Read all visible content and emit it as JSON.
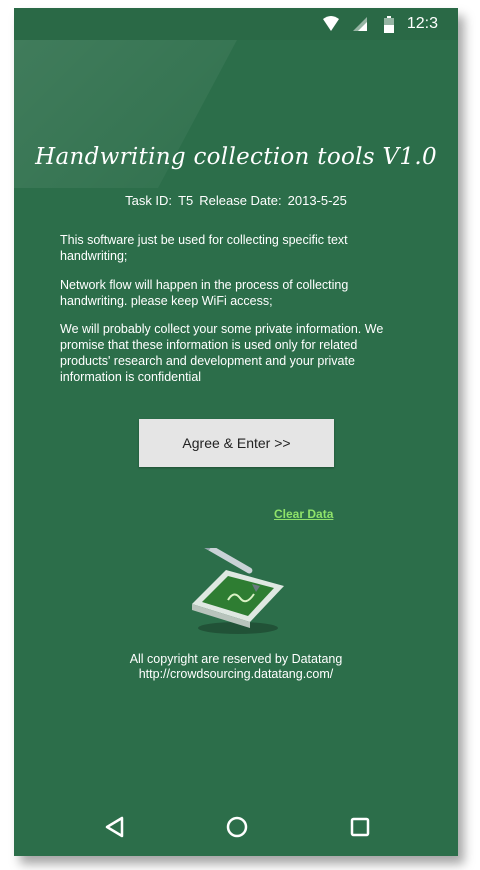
{
  "status_bar": {
    "time": "12:3",
    "icons": [
      "wifi-icon",
      "signal-icon",
      "battery-icon"
    ]
  },
  "title": "Handwriting collection tools V1.0",
  "task": {
    "id_label": "Task ID:",
    "id_value": "T5",
    "date_label": "Release Date:",
    "date_value": "2013-5-25"
  },
  "paragraphs": [
    "This software just be used for collecting specific text handwriting;",
    "Network flow will happen in the process of collecting handwriting. please keep WiFi access;",
    "We will probably collect your some private information. We promise that these information is used only for related products' research and development and your private information is confidential"
  ],
  "agree_button": "Agree & Enter >>",
  "clear_link": "Clear Data",
  "copyright": {
    "line1": "All copyright are reserved by Datatang",
    "line2": "http://crowdsourcing.datatang.com/"
  },
  "nav": [
    "back-icon",
    "home-icon",
    "recents-icon"
  ],
  "colors": {
    "background": "#2c6e4a",
    "link": "#8fe36a",
    "button": "#e5e5e5"
  }
}
